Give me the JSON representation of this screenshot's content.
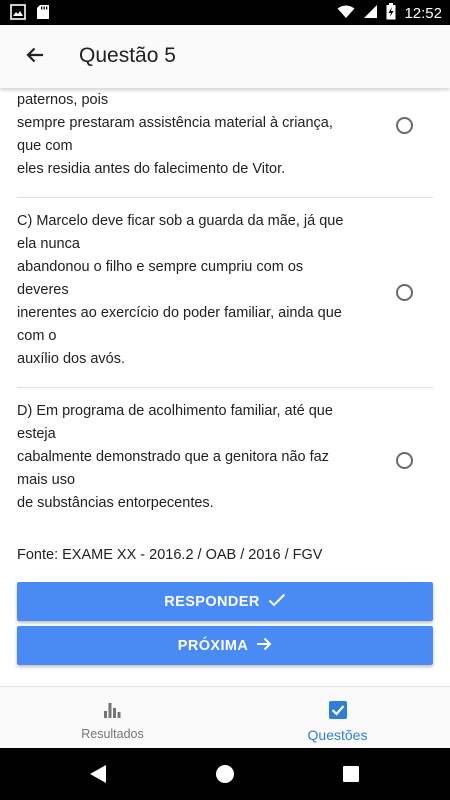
{
  "status_bar": {
    "time": "12:52",
    "icons": [
      "image-icon",
      "sd-card-icon",
      "wifi-icon",
      "signal-icon",
      "battery-charging-icon"
    ]
  },
  "header": {
    "title": "Questão 5",
    "back_icon": "arrow-back-icon"
  },
  "options": [
    {
      "id": "B",
      "lines": [
        "paternos, pois",
        "sempre prestaram assistência material à criança,",
        "que com",
        "eles residia antes do falecimento de Vitor."
      ],
      "selected": false
    },
    {
      "id": "C",
      "lines": [
        "C) Marcelo deve ficar sob a guarda da mãe, já que",
        "ela nunca",
        "abandonou o filho e sempre cumpriu com os",
        "deveres",
        "inerentes ao exercício do poder familiar, ainda que",
        "com o",
        "auxílio dos avós."
      ],
      "selected": false
    },
    {
      "id": "D",
      "lines": [
        "D) Em programa de acolhimento familiar, até que",
        "esteja",
        "cabalmente demonstrado que a genitora não faz",
        "mais uso",
        "de substâncias entorpecentes."
      ],
      "selected": false
    }
  ],
  "source": "Fonte: EXAME XX - 2016.2 / OAB / 2016 / FGV",
  "buttons": {
    "answer_label": "RESPONDER",
    "answer_icon": "check-icon",
    "next_label": "PRÓXIMA",
    "next_icon": "arrow-forward-icon",
    "color": "#4a8af4"
  },
  "bottom_nav": {
    "items": [
      {
        "label": "Resultados",
        "icon": "bar-chart-icon",
        "active": false
      },
      {
        "label": "Questões",
        "icon": "checkbox-icon",
        "active": true
      }
    ],
    "active_color": "#2f7fd8"
  },
  "system_nav": {
    "icons": [
      "back-triangle-icon",
      "home-circle-icon",
      "recents-square-icon"
    ]
  }
}
